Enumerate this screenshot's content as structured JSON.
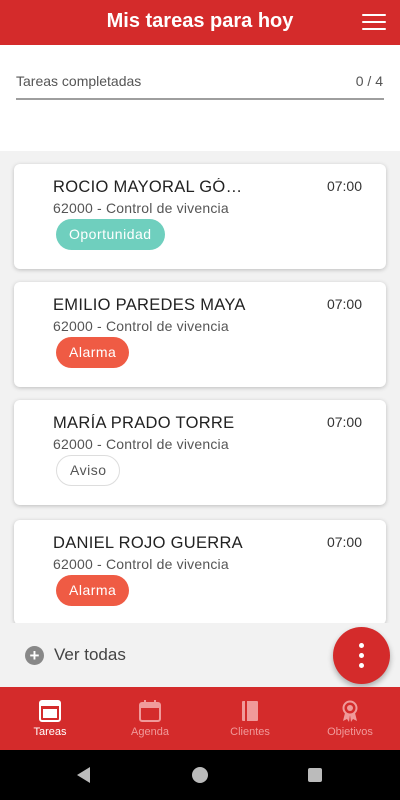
{
  "header": {
    "title": "Mis tareas para hoy",
    "menu_icon": "hamburger-menu-icon"
  },
  "progress": {
    "label": "Tareas completadas",
    "count": "0 / 4",
    "completed": 0,
    "total": 4
  },
  "tasks": [
    {
      "name": "ROCIO MAYORAL GÓ…",
      "time": "07:00",
      "description": "62000 - Control de vivencia",
      "tag": "Oportunidad",
      "tag_type": "op"
    },
    {
      "name": "EMILIO PAREDES MAYA",
      "time": "07:00",
      "description": "62000 - Control de vivencia",
      "tag": "Alarma",
      "tag_type": "al"
    },
    {
      "name": "MARÍA PRADO TORRE",
      "time": "07:00",
      "description": "62000 - Control de vivencia",
      "tag": "Aviso",
      "tag_type": "av"
    },
    {
      "name": "DANIEL ROJO GUERRA",
      "time": "07:00",
      "description": "62000 - Control de vivencia",
      "tag": "Alarma",
      "tag_type": "al"
    }
  ],
  "see_all": {
    "label": "Ver todas"
  },
  "nav": [
    {
      "label": "Tareas",
      "icon": "tasks-icon",
      "active": true
    },
    {
      "label": "Agenda",
      "icon": "calendar-icon",
      "active": false
    },
    {
      "label": "Clientes",
      "icon": "book-icon",
      "active": false
    },
    {
      "label": "Objetivos",
      "icon": "award-icon",
      "active": false
    }
  ],
  "colors": {
    "primary": "#d42b2b",
    "oportunidad": "#6fcfbe",
    "alarma": "#ef5b44"
  }
}
